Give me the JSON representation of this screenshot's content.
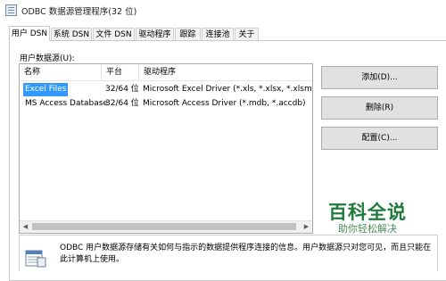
{
  "window": {
    "title": "ODBC 数据源管理程序(32 位)"
  },
  "tabs": [
    {
      "label": "用户 DSN",
      "active": true
    },
    {
      "label": "系统 DSN",
      "active": false
    },
    {
      "label": "文件 DSN",
      "active": false
    },
    {
      "label": "驱动程序",
      "active": false
    },
    {
      "label": "跟踪",
      "active": false
    },
    {
      "label": "连接池",
      "active": false
    },
    {
      "label": "关于",
      "active": false
    }
  ],
  "section_label": "用户数据源(U):",
  "list": {
    "columns": [
      "名称",
      "平台",
      "驱动程序"
    ],
    "rows": [
      {
        "name": "Excel Files",
        "platform": "32/64 位",
        "driver": "Microsoft Excel Driver (*.xls, *.xlsx, *.xlsm, *.xlsb)",
        "selected": true
      },
      {
        "name": "MS Access Database",
        "platform": "32/64 位",
        "driver": "Microsoft Access Driver (*.mdb, *.accdb)",
        "selected": false
      }
    ]
  },
  "buttons": {
    "add": "添加(D)...",
    "remove": "删除(R)",
    "configure": "配置(C)..."
  },
  "info": {
    "line1": "ODBC 用户数据源存储有关如何与指示的数据提供程序连接的信息。用户数据源只对您可见，而且只能在",
    "line2": "此计算机上使用。"
  },
  "watermark": {
    "title": "百科全说",
    "subtitle": "助你轻松解决"
  },
  "colors": {
    "selection": "#3399ff",
    "watermark": "#1f7b3c"
  }
}
